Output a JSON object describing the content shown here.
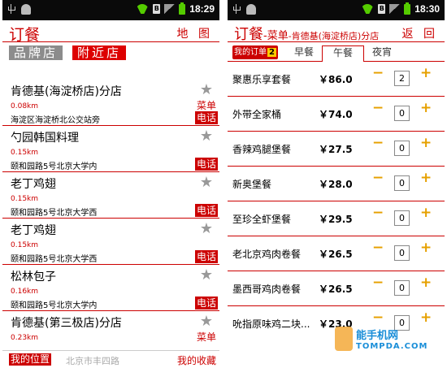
{
  "left": {
    "status": {
      "time": "18:29"
    },
    "title": "订餐",
    "map_button": "地 图",
    "tabs": [
      {
        "label": "品牌店",
        "active": false
      },
      {
        "label": "附近店",
        "active": true
      }
    ],
    "stores": [
      {
        "name": "肯德基(海淀桥店)分店",
        "distance": "0.08km",
        "address": "海淀区海淀桥北公交站旁",
        "menu": "菜单",
        "call": "电话"
      },
      {
        "name": "勺园韩国料理",
        "distance": "0.15km",
        "address": "颐和园路5号北京大学内",
        "menu": "",
        "call": "电话"
      },
      {
        "name": "老丁鸡翅",
        "distance": "0.15km",
        "address": "颐和园路5号北京大学西",
        "menu": "",
        "call": "电话"
      },
      {
        "name": "老丁鸡翅",
        "distance": "0.15km",
        "address": "颐和园路5号北京大学西",
        "menu": "",
        "call": "电话"
      },
      {
        "name": "松林包子",
        "distance": "0.16km",
        "address": "颐和园路5号北京大学内",
        "menu": "",
        "call": "电话"
      },
      {
        "name": "肯德基(第三极店)分店",
        "distance": "0.23km",
        "address": "",
        "menu": "菜单",
        "call": ""
      }
    ],
    "bottom": {
      "location": "我的位置",
      "address": "北京市丰四路",
      "favorites": "我的收藏"
    }
  },
  "right": {
    "status": {
      "time": "18:30"
    },
    "title_main": "订餐",
    "title_sub": "-菜单",
    "title_store": "-肯德基(海淀桥店)分店",
    "back_button": "返 回",
    "my_order_label": "我的订单",
    "my_order_count": "2",
    "meal_tabs": [
      "早餐",
      "午餐",
      "夜宵"
    ],
    "selected_meal": "午餐",
    "minus_symbol": "−",
    "plus_symbol": "+",
    "dishes": [
      {
        "name": "聚惠乐享套餐",
        "price": "￥86.0",
        "qty": "2"
      },
      {
        "name": "外带全家桶",
        "price": "￥74.0",
        "qty": "0"
      },
      {
        "name": "香辣鸡腿堡餐",
        "price": "￥27.5",
        "qty": "0"
      },
      {
        "name": "新奥堡餐",
        "price": "￥28.0",
        "qty": "0"
      },
      {
        "name": "至珍全虾堡餐",
        "price": "￥29.5",
        "qty": "0"
      },
      {
        "name": "老北京鸡肉卷餐",
        "price": "￥26.5",
        "qty": "0"
      },
      {
        "name": "墨西哥鸡肉卷餐",
        "price": "￥26.5",
        "qty": "0"
      },
      {
        "name": "吮指原味鸡二块...",
        "price": "￥23.0",
        "qty": "0"
      }
    ]
  },
  "watermark": {
    "text": "能手机网",
    "sub": "TOMPDA.COM"
  },
  "colors": {
    "accent": "#cc0000",
    "inactive_tab": "#8c8c8c",
    "stepper": "#e6a000",
    "watermark": "#1a8ed8"
  }
}
